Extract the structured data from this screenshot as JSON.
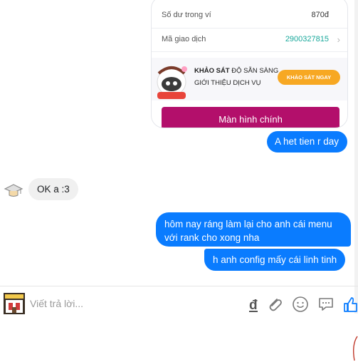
{
  "card": {
    "balance_label": "Số dư trong ví",
    "balance_value": "870đ",
    "txn_label": "Mã giao dịch",
    "txn_value": "2900327815",
    "survey_bold": "KHẢO SÁT",
    "survey_rest": " ĐỘ SẴN SÀNG",
    "survey_line2": "GIỚI THIỆU DỊCH VỤ",
    "survey_button": "KHẢO SÁT NGAY",
    "main_screen_button": "Màn hình chính"
  },
  "messages": {
    "m1": "A het tien r day",
    "m2": "OK a :3",
    "m3_line1": "hôm nay ráng làm lại cho anh cái menu",
    "m3_line2": "với rank cho xong nha",
    "m4": "h anh config mấy cái linh tinh"
  },
  "composer": {
    "placeholder": "Viết trả lời..."
  },
  "colors": {
    "outgoing_bubble": "#0a7cff",
    "incoming_bubble": "#f0f0f0",
    "brand_magenta": "#b30f6b",
    "cta_orange": "#f7a823",
    "txn_teal": "#19a89b"
  }
}
